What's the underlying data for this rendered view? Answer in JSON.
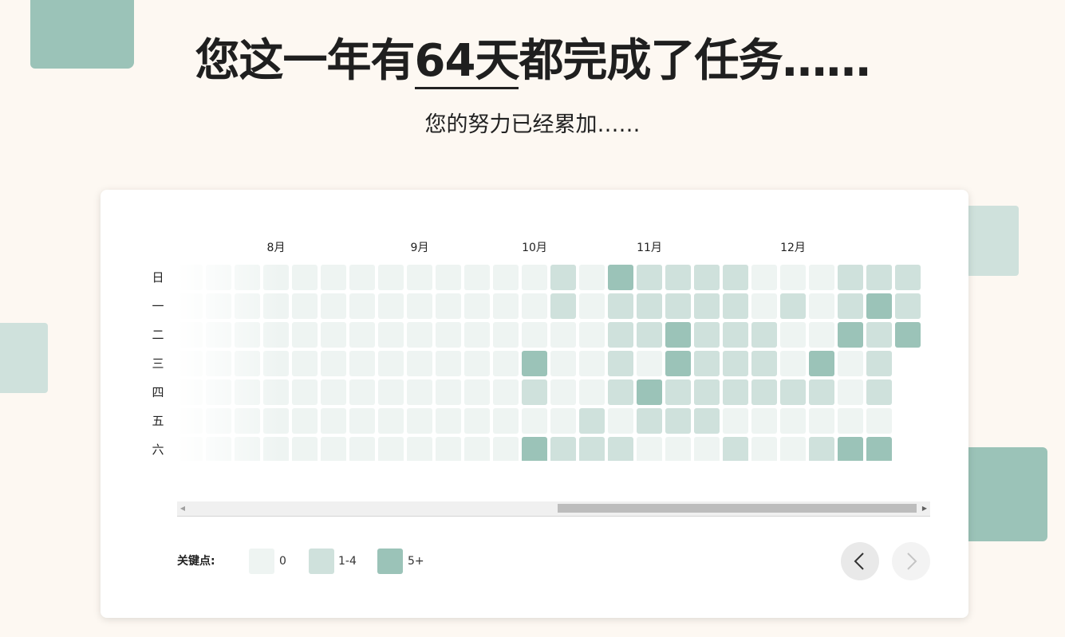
{
  "headline": {
    "before": "您这一年有",
    "highlight": "64天",
    "after": "都完成了任务……"
  },
  "subtitle": "您的努力已经累加……",
  "months": [
    {
      "label": "8月",
      "week": 3
    },
    {
      "label": "9月",
      "week": 8
    },
    {
      "label": "10月",
      "week": 12
    },
    {
      "label": "11月",
      "week": 16
    },
    {
      "label": "12月",
      "week": 21
    }
  ],
  "weekdays": [
    "日",
    "一",
    "二",
    "三",
    "四",
    "五",
    "六"
  ],
  "levels": [
    "0000000000000000000000000",
    "0000000000000000000000000",
    "0000000000000000000000000",
    "0000000000000000000000000",
    "0000000000000000000000000",
    "0000000000000000000000000",
    "0000000000000000000000000"
  ],
  "heatmap": {
    "weeks": 26,
    "rows": [
      "00000000000001021111000111",
      "00000000000001011111010121",
      "00000000000000011211100212",
      "0000000000002001021110201  ",
      "0000000000001001211111101",
      "0000000000000010111000000",
      "0000000000002111000100122"
    ]
  },
  "legend": {
    "title": "关键点:",
    "items": [
      {
        "label": "0",
        "color": "#eef4f2"
      },
      {
        "label": "1-4",
        "color": "#cfe1dc"
      },
      {
        "label": "5+",
        "color": "#9bc3b8"
      }
    ]
  },
  "colors": {
    "level0": "#eef4f2",
    "level1": "#cfe1dc",
    "level2": "#9bc3b8"
  },
  "nav": {
    "prev_icon": "chevron-left-icon",
    "next_icon": "chevron-right-icon",
    "next_disabled": true
  }
}
